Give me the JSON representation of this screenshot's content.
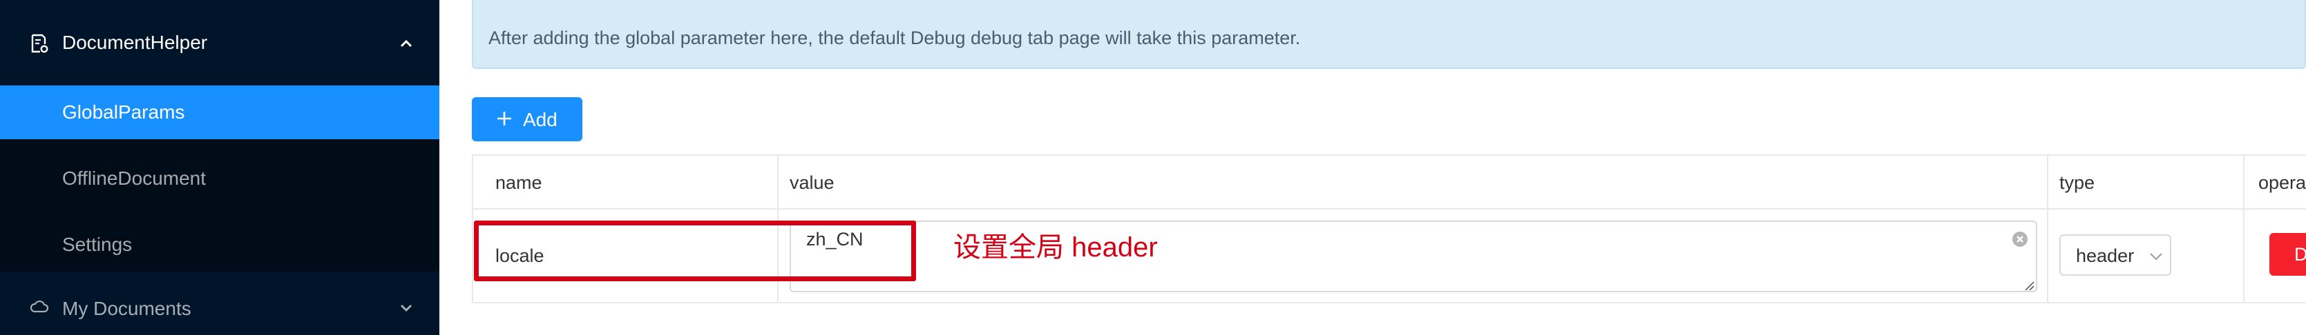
{
  "sidebar": {
    "group": {
      "label": "DocumentHelper",
      "icon": "document-settings-icon",
      "state": "expanded"
    },
    "items": [
      {
        "label": "GlobalParams",
        "active": true
      },
      {
        "label": "OfflineDocument",
        "active": false
      },
      {
        "label": "Settings",
        "active": false
      }
    ],
    "group2": {
      "label": "My Documents",
      "icon": "cloud-icon",
      "state": "collapsed"
    }
  },
  "alert": {
    "text": "After adding the global parameter here, the default Debug debug tab page will take this parameter."
  },
  "toolbar": {
    "add_label": "Add"
  },
  "table": {
    "headers": {
      "name": "name",
      "value": "value",
      "type": "type",
      "operation": "opera"
    },
    "rows": [
      {
        "name": "locale",
        "value": "zh_CN",
        "type": "header",
        "action": "D"
      }
    ]
  },
  "annotation": {
    "text": "设置全局 header",
    "color": "#d40014"
  },
  "colors": {
    "sidebar_bg": "#001529",
    "active": "#1890ff",
    "danger": "#f5222d",
    "alert_bg": "#d6ebf6"
  }
}
